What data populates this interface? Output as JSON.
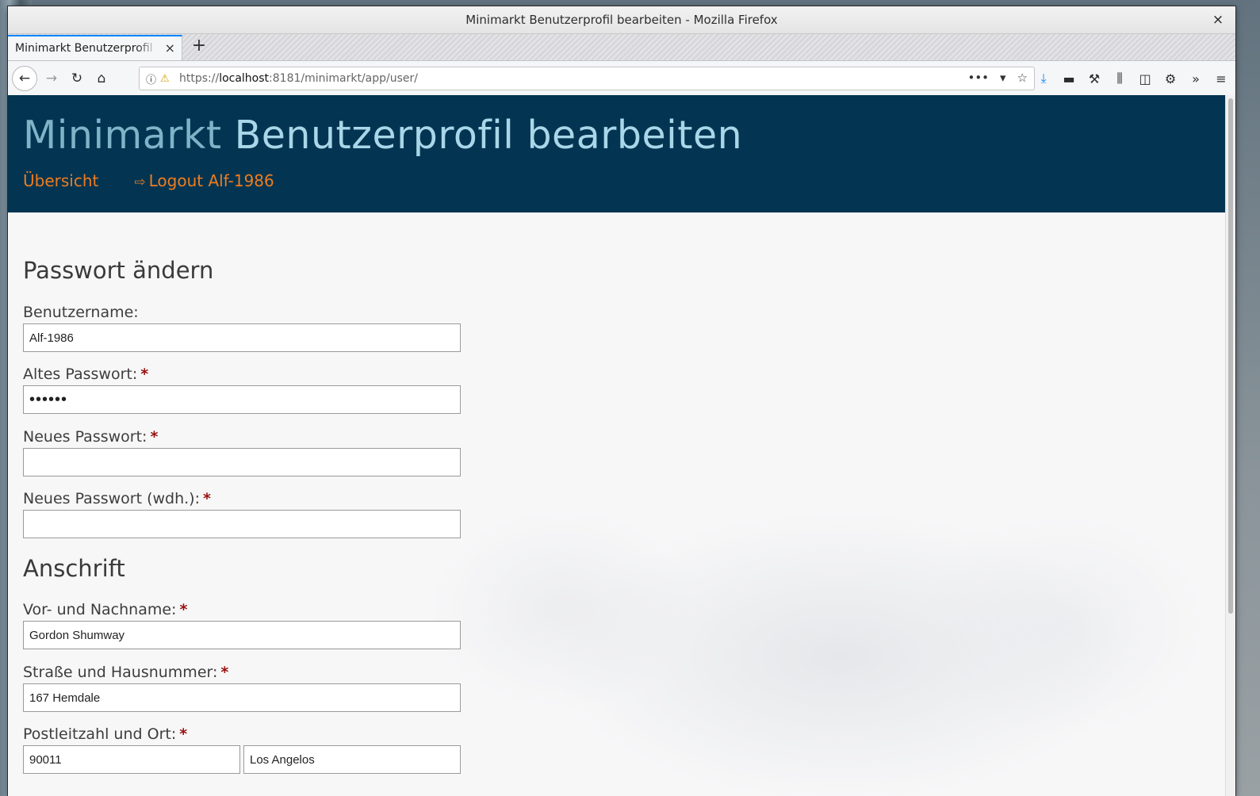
{
  "window": {
    "title": "Minimarkt Benutzerprofil bearbeiten - Mozilla Firefox",
    "close_glyph": "×"
  },
  "browser": {
    "tab_label": "Minimarkt Benutzerprofil bearbeiten",
    "tab_close": "×",
    "new_tab": "+",
    "url_scheme": "https://",
    "url_host": "localhost",
    "url_rest": ":8181/minimarkt/app/user/",
    "icons": {
      "back": "←",
      "forward": "→",
      "reload": "↻",
      "home": "⌂",
      "info": "ⓘ",
      "warning": "⚠",
      "more": "•••",
      "pocket": "▾",
      "bookmark": "☆",
      "download": "⤓",
      "screenshot": "▬",
      "tools": "⚒",
      "library": "⫼",
      "sidebar": "◫",
      "extension": "⚙",
      "overflow": "»",
      "menu": "≡"
    }
  },
  "header": {
    "brand": "Minimarkt",
    "page_title": "Benutzerprofil bearbeiten",
    "nav": {
      "overview": "Übersicht",
      "logout_icon": "⇨",
      "logout": "Logout Alf-1986"
    },
    "colors": {
      "background": "#033552",
      "link": "#f07c1e",
      "title": "#a9d6e8"
    }
  },
  "form": {
    "password_section": "Passwort ändern",
    "required_mark": "*",
    "username_label": "Benutzername:",
    "username_value": "Alf-1986",
    "old_password_label": "Altes Passwort:",
    "old_password_value": "••••••",
    "new_password_label": "Neues Passwort:",
    "new_password_value": "",
    "repeat_password_label": "Neues Passwort (wdh.):",
    "repeat_password_value": "",
    "address_section": "Anschrift",
    "name_label": "Vor- und Nachname:",
    "name_value": "Gordon Shumway",
    "street_label": "Straße und Hausnummer:",
    "street_value": "167 Hemdale",
    "city_label": "Postleitzahl und Ort:",
    "zip_value": "90011",
    "city_value": "Los Angelos"
  }
}
